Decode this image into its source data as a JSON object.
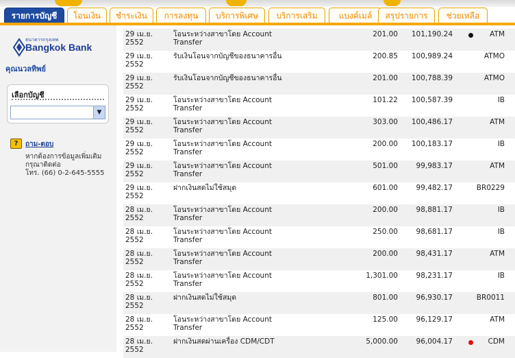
{
  "tabs": [
    {
      "label": "รายการบัญชี",
      "active": true
    },
    {
      "label": "โอนเงิน",
      "active": false
    },
    {
      "label": "ชำระเงิน",
      "active": false
    },
    {
      "label": "การลงทุน",
      "active": false
    },
    {
      "label": "บริการพิเศษ",
      "active": false
    },
    {
      "label": "บริการเสริม",
      "active": false
    },
    {
      "label": "แบงค์เมล์",
      "active": false
    },
    {
      "label": "สรุปรายการ",
      "active": false
    },
    {
      "label": "ช่วยเหลือ",
      "active": false
    }
  ],
  "sidebar": {
    "logo_thai": "ธนาคารกรุงเทพ",
    "logo_en": "Bangkok Bank",
    "greeting": "คุณนวลทิพย์",
    "account_title": "เลือกบัญชี",
    "account_value": "",
    "help_link": "ถาม-ตอบ",
    "help_text_1": "หากต้องการข้อมูลเพิ่มเติม",
    "help_text_2": "กรุณาติดต่อ",
    "help_phone": "โทร. (66) 0-2-645-5555"
  },
  "colors": {
    "brand_blue": "#1e4ba0",
    "tab_orange": "#f08a00",
    "accent_bar": "#f5a800",
    "marker_black": "#111111",
    "marker_red": "#e01010"
  },
  "transactions": [
    {
      "date": "29 เม.ย.",
      "year": "2552",
      "desc1": "โอนระหว่างสาขาโดย Account",
      "desc2": "Transfer",
      "amount": "201.00",
      "balance": "101,190.24",
      "marker": "black",
      "channel": "ATM"
    },
    {
      "date": "29 เม.ย.",
      "year": "2552",
      "desc1": "รับเงินโอนจากบัญชีของธนาคารอื่น",
      "desc2": "",
      "amount": "200.85",
      "balance": "100,989.24",
      "marker": "",
      "channel": "ATMO"
    },
    {
      "date": "29 เม.ย.",
      "year": "2552",
      "desc1": "รับเงินโอนจากบัญชีของธนาคารอื่น",
      "desc2": "",
      "amount": "201.00",
      "balance": "100,788.39",
      "marker": "",
      "channel": "ATMO"
    },
    {
      "date": "29 เม.ย.",
      "year": "2552",
      "desc1": "โอนระหว่างสาขาโดย Account",
      "desc2": "Transfer",
      "amount": "101.22",
      "balance": "100,587.39",
      "marker": "",
      "channel": "IB"
    },
    {
      "date": "29 เม.ย.",
      "year": "2552",
      "desc1": "โอนระหว่างสาขาโดย Account",
      "desc2": "Transfer",
      "amount": "303.00",
      "balance": "100,486.17",
      "marker": "",
      "channel": "ATM"
    },
    {
      "date": "29 เม.ย.",
      "year": "2552",
      "desc1": "โอนระหว่างสาขาโดย Account",
      "desc2": "Transfer",
      "amount": "200.00",
      "balance": "100,183.17",
      "marker": "",
      "channel": "IB"
    },
    {
      "date": "29 เม.ย.",
      "year": "2552",
      "desc1": "โอนระหว่างสาขาโดย Account",
      "desc2": "Transfer",
      "amount": "501.00",
      "balance": "99,983.17",
      "marker": "",
      "channel": "ATM"
    },
    {
      "date": "29 เม.ย.",
      "year": "2552",
      "desc1": "ฝากเงินสดไม่ใช้สมุด",
      "desc2": "",
      "amount": "601.00",
      "balance": "99,482.17",
      "marker": "",
      "channel": "BR0229"
    },
    {
      "date": "28 เม.ย.",
      "year": "2552",
      "desc1": "โอนระหว่างสาขาโดย Account",
      "desc2": "Transfer",
      "amount": "200.00",
      "balance": "98,881.17",
      "marker": "",
      "channel": "IB"
    },
    {
      "date": "28 เม.ย.",
      "year": "2552",
      "desc1": "โอนระหว่างสาขาโดย Account",
      "desc2": "Transfer",
      "amount": "250.00",
      "balance": "98,681.17",
      "marker": "",
      "channel": "IB"
    },
    {
      "date": "28 เม.ย.",
      "year": "2552",
      "desc1": "โอนระหว่างสาขาโดย Account",
      "desc2": "Transfer",
      "amount": "200.00",
      "balance": "98,431.17",
      "marker": "",
      "channel": "ATM"
    },
    {
      "date": "28 เม.ย.",
      "year": "2552",
      "desc1": "โอนระหว่างสาขาโดย Account",
      "desc2": "Transfer",
      "amount": "1,301.00",
      "balance": "98,231.17",
      "marker": "",
      "channel": "IB"
    },
    {
      "date": "28 เม.ย.",
      "year": "2552",
      "desc1": "ฝากเงินสดไม่ใช้สมุด",
      "desc2": "",
      "amount": "801.00",
      "balance": "96,930.17",
      "marker": "",
      "channel": "BR0011"
    },
    {
      "date": "28 เม.ย.",
      "year": "2552",
      "desc1": "โอนระหว่างสาขาโดย Account",
      "desc2": "Transfer",
      "amount": "125.00",
      "balance": "96,129.17",
      "marker": "",
      "channel": "ATM"
    },
    {
      "date": "28 เม.ย.",
      "year": "2552",
      "desc1": "ฝากเงินสดผ่านเครื่อง CDM/CDT",
      "desc2": "",
      "amount": "5,000.00",
      "balance": "96,004.17",
      "marker": "red",
      "channel": "CDM"
    }
  ]
}
